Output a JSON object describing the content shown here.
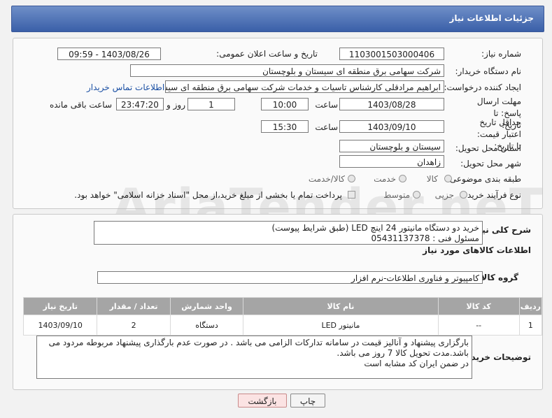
{
  "header": {
    "title": "جزئیات اطلاعات نیاز"
  },
  "form": {
    "need_number": {
      "label": "شماره نیاز:",
      "value": "1103001503000406"
    },
    "announce_datetime": {
      "label": "تاریخ و ساعت اعلان عمومی:",
      "value": "1403/08/26 - 09:59"
    },
    "buyer_org": {
      "label": "نام دستگاه خریدار:",
      "value": "شرکت سهامی برق منطقه ای سیستان و بلوچستان"
    },
    "requester": {
      "label": "ایجاد کننده درخواست:",
      "value": "ابراهیم مرادقلی کارشناس تاسیات و خدمات شرکت سهامی برق منطقه ای سیستان",
      "contact_link": "اطلاعات تماس خریدار"
    },
    "reply_deadline": {
      "label": "مهلت ارسال پاسخ: تا تاریخ:",
      "date": "1403/08/28",
      "time_label": "ساعت",
      "time": "10:00",
      "days": "1",
      "days_label": "روز و",
      "remaining": "23:47:20",
      "remaining_label": "ساعت باقی مانده"
    },
    "price_validity": {
      "label": "حداقل تاریخ اعتبار قیمت: تا تاریخ:",
      "date": "1403/09/10",
      "time_label": "ساعت",
      "time": "15:30"
    },
    "delivery_province": {
      "label": "استان محل تحویل:",
      "value": "سیستان و بلوچستان"
    },
    "delivery_city": {
      "label": "شهر محل تحویل:",
      "value": "زاهدان"
    },
    "category": {
      "label": "طبقه بندی موضوعی:",
      "options": [
        "کالا",
        "خدمت",
        "کالا/خدمت"
      ]
    },
    "purchase_process": {
      "label": "نوع فرآیند خرید :",
      "options": [
        "جزیی",
        "متوسط"
      ],
      "note": "پرداخت تمام یا بخشی از مبلغ خرید،از محل \"اسناد خزانه اسلامی\" خواهد بود."
    }
  },
  "general_description": {
    "label": "شرح کلی نیاز:",
    "lines": [
      "خرید دو دستگاه مانیتور 24 اینچ LED (طبق شرایط پیوست)",
      "مسئول فنی : 05431137378"
    ]
  },
  "items_section": {
    "title": "اطلاعات کالاهای مورد نیاز",
    "group_label": "گروه کالا:",
    "group_value": "کامپیوتر و فناوری اطلاعات-نرم افزار",
    "columns": [
      "ردیف",
      "کد کالا",
      "نام کالا",
      "واحد شمارش",
      "تعداد / مقدار",
      "تاریخ نیاز"
    ],
    "rows": [
      {
        "row": "1",
        "code": "--",
        "name": "مانیتور LED",
        "unit": "دستگاه",
        "qty": "2",
        "date": "1403/09/10"
      }
    ]
  },
  "buyer_notes": {
    "label": "توضیحات خریدار:",
    "lines": [
      "بارگزاری پیشنهاد و آنالیز قیمت در سامانه تدارکات الزامی می باشد . در صورت عدم بارگذاری پیشنهاد مربوطه مردود می",
      "باشد.مدت تحویل کالا 7 روز می باشد.",
      "در ضمن ایران کد مشابه است"
    ]
  },
  "buttons": {
    "print": "چاپ",
    "back": "بازگشت"
  },
  "watermark": {
    "text": "AriaTender.neT"
  }
}
